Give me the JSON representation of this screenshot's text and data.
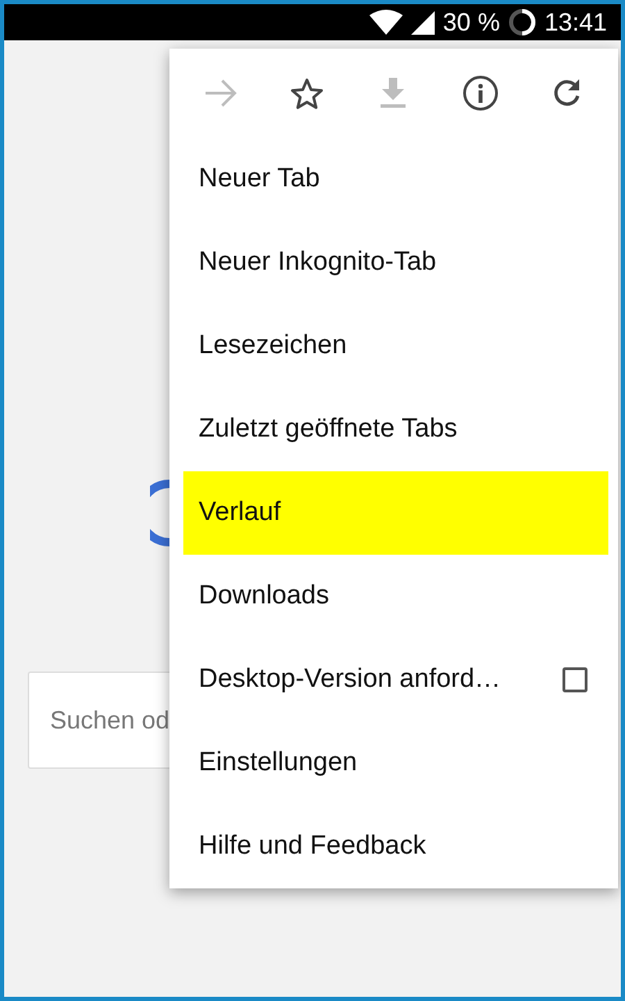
{
  "status_bar": {
    "battery": "30 %",
    "time": "13:41"
  },
  "search": {
    "placeholder": "Suchen od"
  },
  "menu": {
    "icons": [
      {
        "kind": "forward",
        "disabled": true
      },
      {
        "kind": "star",
        "disabled": false
      },
      {
        "kind": "download",
        "disabled": true
      },
      {
        "kind": "info",
        "disabled": false
      },
      {
        "kind": "reload",
        "disabled": false
      }
    ],
    "items": [
      {
        "kind": "plain",
        "label": "Neuer Tab",
        "selected": false
      },
      {
        "kind": "plain",
        "label": "Neuer Inkognito-Tab",
        "selected": false
      },
      {
        "kind": "plain",
        "label": "Lesezeichen",
        "selected": false
      },
      {
        "kind": "plain",
        "label": "Zuletzt geöffnete Tabs",
        "selected": false
      },
      {
        "kind": "plain",
        "label": "Verlauf",
        "selected": true
      },
      {
        "kind": "plain",
        "label": "Downloads",
        "selected": false
      },
      {
        "kind": "checkbox",
        "label": "Desktop-Version anford…",
        "checked": false,
        "selected": false
      },
      {
        "kind": "plain",
        "label": "Einstellungen",
        "selected": false
      },
      {
        "kind": "plain",
        "label": "Hilfe und Feedback",
        "selected": false
      }
    ]
  }
}
